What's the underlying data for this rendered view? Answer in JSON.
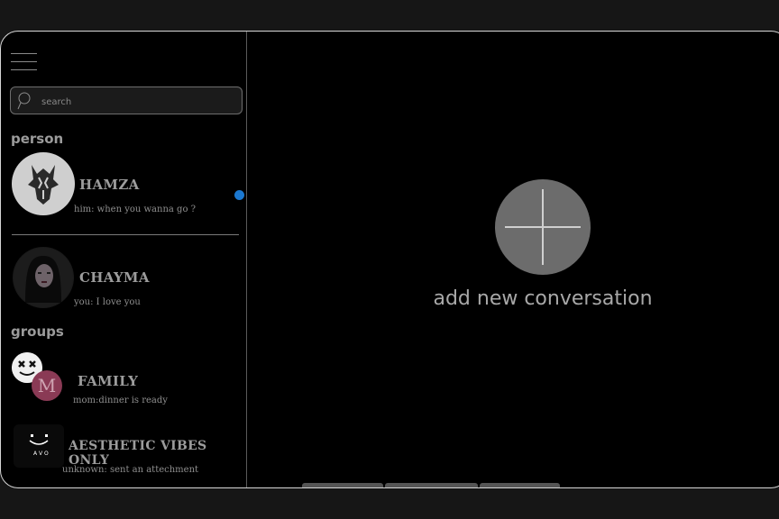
{
  "search": {
    "placeholder": "search"
  },
  "sections": {
    "person": "person",
    "groups": "groups"
  },
  "conversations": [
    {
      "name": "HAMZA",
      "preview": "him: when you wanna go ?",
      "unread": true,
      "avatar_icon": "wolf-avatar-icon"
    },
    {
      "name": "CHAYMA",
      "preview": "you: I love you",
      "unread": false,
      "avatar_icon": "portrait-avatar-icon"
    }
  ],
  "groups": [
    {
      "name": "FAMILY",
      "preview": "mom:dinner is ready",
      "avatar_letter": "M",
      "avatar_icon": "marshmello-avatar-icon"
    },
    {
      "name": "AESTHETIC VIBES ONLY",
      "preview": "unknown: sent an attechment",
      "avatar_icon": "smiley-avatar-icon"
    }
  ],
  "main": {
    "add_label": "add new conversation"
  },
  "colors": {
    "accent_unread": "#1b78d0",
    "background": "#000000",
    "group_avatar": "#8a3a55"
  }
}
